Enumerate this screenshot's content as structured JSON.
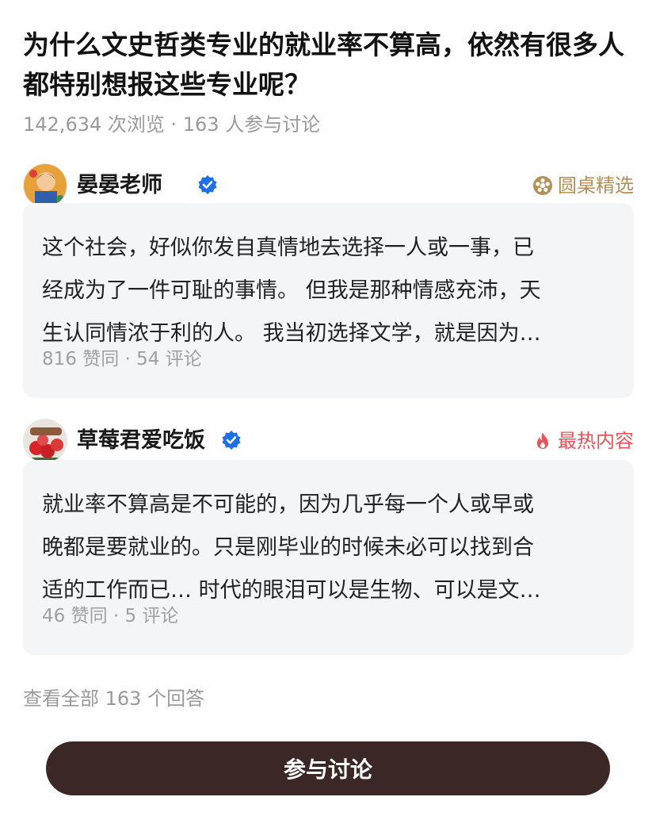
{
  "question": {
    "title": "为什么文史哲类专业的就业率不算高，依然有很多人都特别想报这些专业呢？",
    "stats": "142,634 次浏览 · 163 人参与讨论"
  },
  "answers": [
    {
      "author": "晏晏老师",
      "verified": true,
      "tag": "圆桌精选",
      "tag_icon": "roundtable-badge-icon",
      "tag_color": "#b48f56",
      "excerpt_lines": [
        "这个社会，好似你发自真情地去选择一人或一事，已",
        "经成为了一件可耻的事情。 但我是那种情感充沛，天",
        "生认同情浓于利的人。 我当初选择文学，就是因为…"
      ],
      "stats": "816 赞同 · 54 评论"
    },
    {
      "author": "草莓君爱吃饭",
      "verified": true,
      "tag": "最热内容",
      "tag_icon": "flame-icon",
      "tag_color": "#e8545a",
      "excerpt_lines": [
        "就业率不算高是不可能的，因为几乎每一个人或早或",
        "晚都是要就业的。只是刚毕业的时候未必可以找到合",
        "适的工作而已… 时代的眼泪可以是生物、可以是文…"
      ],
      "stats": "46 赞同 · 5 评论"
    }
  ],
  "footer": {
    "view_all": "查看全部 163 个回答",
    "cta_label": "参与讨论"
  },
  "colors": {
    "verified_blue": "#1f6fe5",
    "cta_background": "#3b2826",
    "card_background": "#f4f5f7"
  }
}
